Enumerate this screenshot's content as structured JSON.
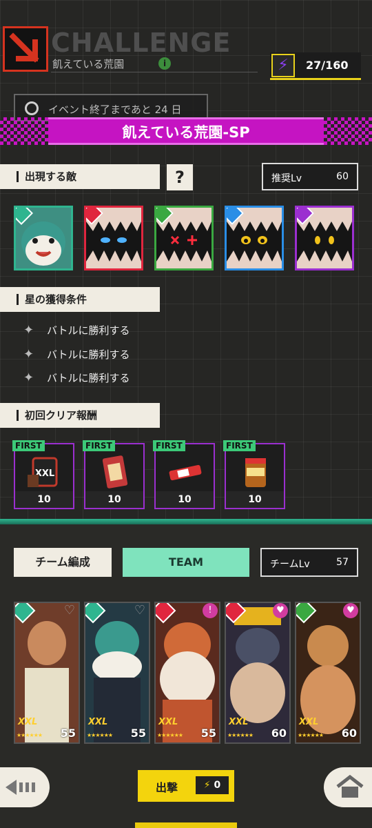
{
  "header": {
    "title": "CHALLENGE",
    "subtitle": "飢えている荒園",
    "info_icon": "info-icon",
    "stamina": {
      "icon": "lightning-icon",
      "value": "27/160"
    }
  },
  "event": {
    "timer_text": "イベント終了まであと 24 日"
  },
  "stage": {
    "name": "飢えている荒園-SP"
  },
  "enemies_section": {
    "label": "出現する敵",
    "help_label": "?",
    "recommended_label": "推奨Lv",
    "recommended_value": "60",
    "enemies": [
      {
        "name": "enemy-1",
        "badge_color": "#2fb58f",
        "frame_color": "#2fb58f"
      },
      {
        "name": "enemy-2",
        "badge_color": "#e0263e",
        "frame_color": "#e0263e"
      },
      {
        "name": "enemy-3",
        "badge_color": "#3aa841",
        "frame_color": "#3aa841"
      },
      {
        "name": "enemy-4",
        "badge_color": "#2a8ee6",
        "frame_color": "#2a8ee6"
      },
      {
        "name": "enemy-5",
        "badge_color": "#9b2fd0",
        "frame_color": "#9b2fd0"
      }
    ]
  },
  "star_conditions": {
    "label": "星の獲得条件",
    "items": [
      "バトルに勝利する",
      "バトルに勝利する",
      "バトルに勝利する"
    ]
  },
  "first_rewards": {
    "label": "初回クリア報酬",
    "items": [
      {
        "badge": "FIRST",
        "qty": "10",
        "icon": "protein-tub-icon"
      },
      {
        "badge": "FIRST",
        "qty": "10",
        "icon": "snack-pack-icon"
      },
      {
        "badge": "FIRST",
        "qty": "10",
        "icon": "protein-bar-icon"
      },
      {
        "badge": "FIRST",
        "qty": "10",
        "icon": "nuts-jar-icon"
      }
    ]
  },
  "team": {
    "formation_label": "チーム編成",
    "team_label": "TEAM",
    "team_lv_label": "チームLv",
    "team_lv_value": "57",
    "members": [
      {
        "level": "55",
        "rank": "XXL",
        "role_color": "#2fb58f",
        "heart": "♡"
      },
      {
        "level": "55",
        "rank": "XXL",
        "role_color": "#2fb58f",
        "heart": "♡"
      },
      {
        "level": "55",
        "rank": "XXL",
        "role_color": "#e0263e",
        "heart": "!"
      },
      {
        "level": "60",
        "rank": "XXL",
        "role_color": "#e0263e",
        "heart": "♥"
      },
      {
        "level": "60",
        "rank": "XXL",
        "role_color": "#3aa841",
        "heart": "♥"
      }
    ]
  },
  "footer": {
    "sortie_label": "出撃",
    "sortie_cost": "0",
    "back_icon": "back-icon",
    "home_icon": "home-icon"
  }
}
